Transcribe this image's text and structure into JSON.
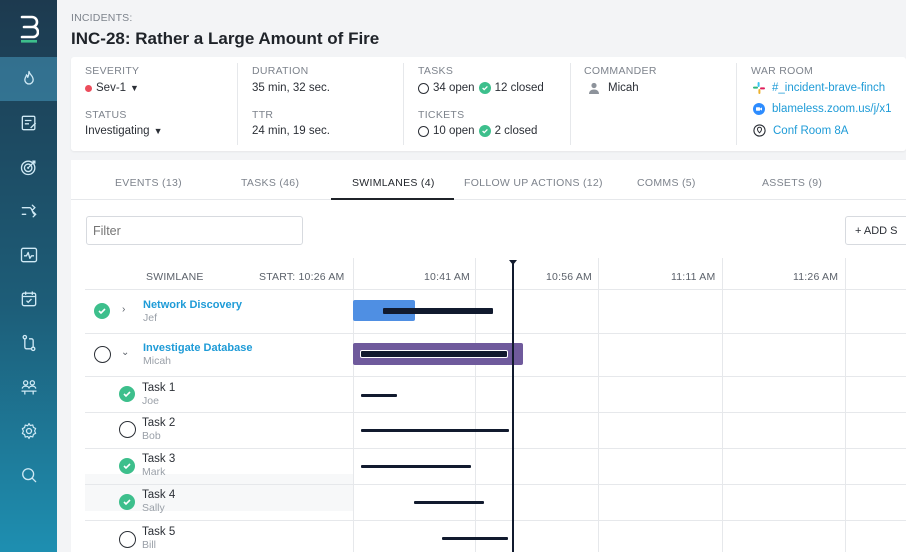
{
  "colors": {
    "accent": "#1e9bd7",
    "success": "#3dbf8c",
    "severity_dot": "#ec4d5c",
    "lane_blue": "#4f8fe3",
    "lane_purple": "#6f5a9c",
    "bar": "#111a2e"
  },
  "sidebar": {
    "logo": "B",
    "items": [
      {
        "icon": "fire-icon",
        "active": true
      },
      {
        "icon": "notes-icon",
        "active": false
      },
      {
        "icon": "target-icon",
        "active": false
      },
      {
        "icon": "shuffle-icon",
        "active": false
      },
      {
        "icon": "pulse-icon",
        "active": false
      },
      {
        "icon": "calendar-check-icon",
        "active": false
      },
      {
        "icon": "git-branch-icon",
        "active": false
      },
      {
        "icon": "team-icon",
        "active": false
      },
      {
        "icon": "gear-icon",
        "active": false
      },
      {
        "icon": "search-icon",
        "active": false
      }
    ]
  },
  "header": {
    "breadcrumb": "INCIDENTS:",
    "title": "INC-28: Rather a Large Amount of Fire"
  },
  "info": {
    "severity": {
      "label": "SEVERITY",
      "value": "Sev-1"
    },
    "status": {
      "label": "STATUS",
      "value": "Investigating"
    },
    "duration": {
      "label": "DURATION",
      "value": "35 min, 32 sec."
    },
    "ttr": {
      "label": "TTR",
      "value": "24 min, 19 sec."
    },
    "tasks": {
      "label": "TASKS",
      "open": "34 open",
      "closed": "12 closed"
    },
    "tickets": {
      "label": "TICKETS",
      "open": "10 open",
      "closed": "2 closed"
    },
    "commander": {
      "label": "COMMANDER",
      "value": "Micah"
    },
    "war_room": {
      "label": "WAR ROOM",
      "slack": "#_incident-brave-finch",
      "zoom": "blameless.zoom.us/j/x1",
      "room": "Conf Room 8A"
    }
  },
  "tabs": [
    {
      "label": "EVENTS (13)",
      "active": false
    },
    {
      "label": "TASKS (46)",
      "active": false
    },
    {
      "label": "SWIMLANES (4)",
      "active": true
    },
    {
      "label": "FOLLOW UP ACTIONS (12)",
      "active": false
    },
    {
      "label": "COMMS (5)",
      "active": false
    },
    {
      "label": "ASSETS (9)",
      "active": false
    }
  ],
  "filter": {
    "placeholder": "Filter"
  },
  "add_button": "+ ADD S",
  "timeline": {
    "col_swimlane": "SWIMLANE",
    "col_start": "START: 10:26 AM",
    "times": [
      "10:41 AM",
      "10:56 AM",
      "11:11 AM",
      "11:26 AM"
    ],
    "lanes": [
      {
        "name": "Network Discovery",
        "owner": "Jef",
        "done": true,
        "expanded": false
      },
      {
        "name": "Investigate Database",
        "owner": "Micah",
        "done": false,
        "expanded": true
      }
    ],
    "tasks": [
      {
        "name": "Task 1",
        "owner": "Joe",
        "done": true
      },
      {
        "name": "Task 2",
        "owner": "Bob",
        "done": false
      },
      {
        "name": "Task 3",
        "owner": "Mark",
        "done": true
      },
      {
        "name": "Task 4",
        "owner": "Sally",
        "done": true
      },
      {
        "name": "Task 5",
        "owner": "Bill",
        "done": false
      }
    ]
  }
}
